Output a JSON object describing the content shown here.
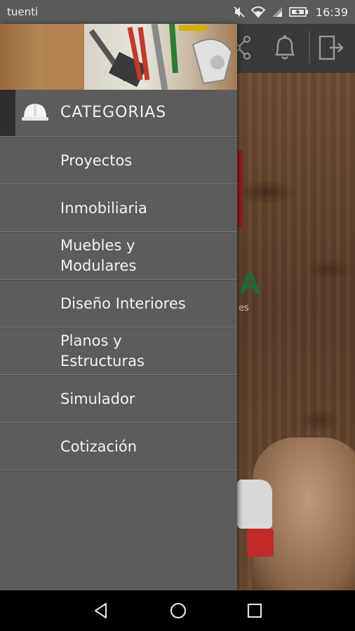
{
  "status_bar": {
    "carrier": "tuenti",
    "time": "16:39",
    "icons": [
      "mute-icon",
      "wifi-icon",
      "signal-icon",
      "battery-icon"
    ]
  },
  "background_app": {
    "header_icons": [
      "share-icon",
      "bell-icon",
      "logout-icon"
    ],
    "partial_logo_text": "A",
    "partial_tagline": "es"
  },
  "drawer": {
    "header_image": "tools-banner",
    "category": {
      "icon": "helmet-icon",
      "title": "CATEGORIAS"
    },
    "items": [
      {
        "label": "Proyectos"
      },
      {
        "label": "Inmobiliaria"
      },
      {
        "label": "Muebles y\nModulares"
      },
      {
        "label": "Diseño Interiores"
      },
      {
        "label": "Planos y\nEstructuras"
      },
      {
        "label": "Simulador"
      },
      {
        "label": "Cotización"
      }
    ]
  },
  "nav_bar": {
    "buttons": [
      "back-icon",
      "home-icon",
      "recents-icon"
    ]
  },
  "colors": {
    "drawer_bg": "#5c5c5c",
    "header_bg": "#3a3a3a",
    "status_bar": "#5a5a5a",
    "accent_green": "#1f6b3a"
  }
}
